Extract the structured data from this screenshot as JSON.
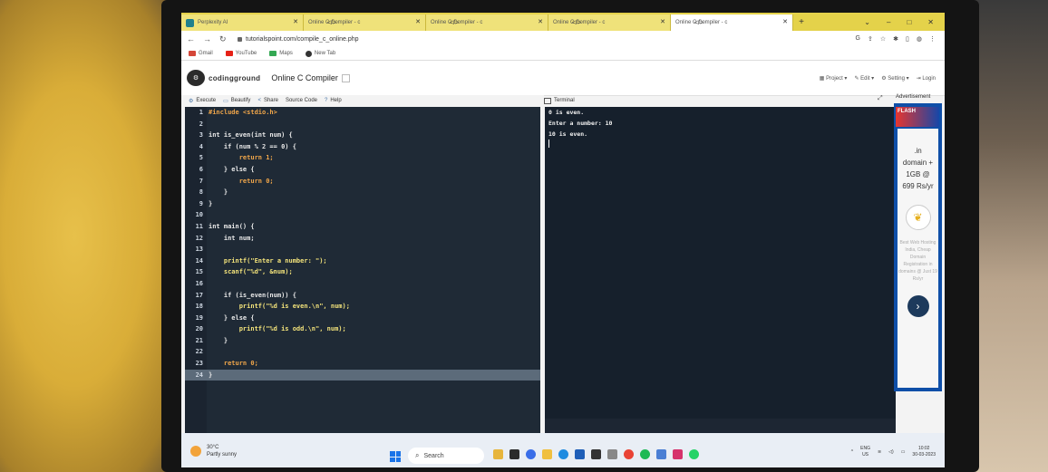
{
  "browser": {
    "tabs": [
      {
        "label": "Perplexity AI",
        "active": false
      },
      {
        "label": "Online C Compiler - c",
        "active": false
      },
      {
        "label": "Online C Compiler - c",
        "active": false
      },
      {
        "label": "Online C Compiler - c",
        "active": false
      },
      {
        "label": "Online C Compiler - c",
        "active": true
      }
    ],
    "url": "tutorialspoint.com/compile_c_online.php",
    "bookmarks": [
      "Gmail",
      "YouTube",
      "Maps",
      "New Tab"
    ]
  },
  "site": {
    "logo_text": "codingground",
    "title": "Online C Compiler",
    "menu": [
      "Project",
      "Edit",
      "Setting",
      "Login"
    ]
  },
  "toolbar": {
    "execute": "Execute",
    "beautify": "Beautify",
    "share": "Share",
    "source_code": "Source Code",
    "help": "Help",
    "terminal": "Terminal",
    "advertisement": "Advertisement"
  },
  "code_lines": [
    "#include <stdio.h>",
    "",
    "int is_even(int num) {",
    "    if (num % 2 == 0) {",
    "        return 1;",
    "    } else {",
    "        return 0;",
    "    }",
    "}",
    "",
    "int main() {",
    "    int num;",
    "",
    "    printf(\"Enter a number: \");",
    "    scanf(\"%d\", &num);",
    "",
    "    if (is_even(num)) {",
    "        printf(\"%d is even.\\n\", num);",
    "    } else {",
    "        printf(\"%d is odd.\\n\", num);",
    "    }",
    "",
    "    return 0;",
    "}"
  ],
  "terminal_lines": [
    "0 is even.",
    "Enter a number: 10",
    "10 is even."
  ],
  "ad": {
    "flash": "FLASH",
    "lines": [
      ".in",
      "domain +",
      "1GB @",
      "699 Rs/yr"
    ],
    "small": "Best Web Hosting India, Cheap Domain Registration in domains @ Just 19 Rs/yr"
  },
  "taskbar": {
    "temperature": "30°C",
    "weather": "Partly sunny",
    "search": "Search",
    "lang": "ENG",
    "region": "US",
    "time": "10:02",
    "date": "30-03-2023"
  }
}
